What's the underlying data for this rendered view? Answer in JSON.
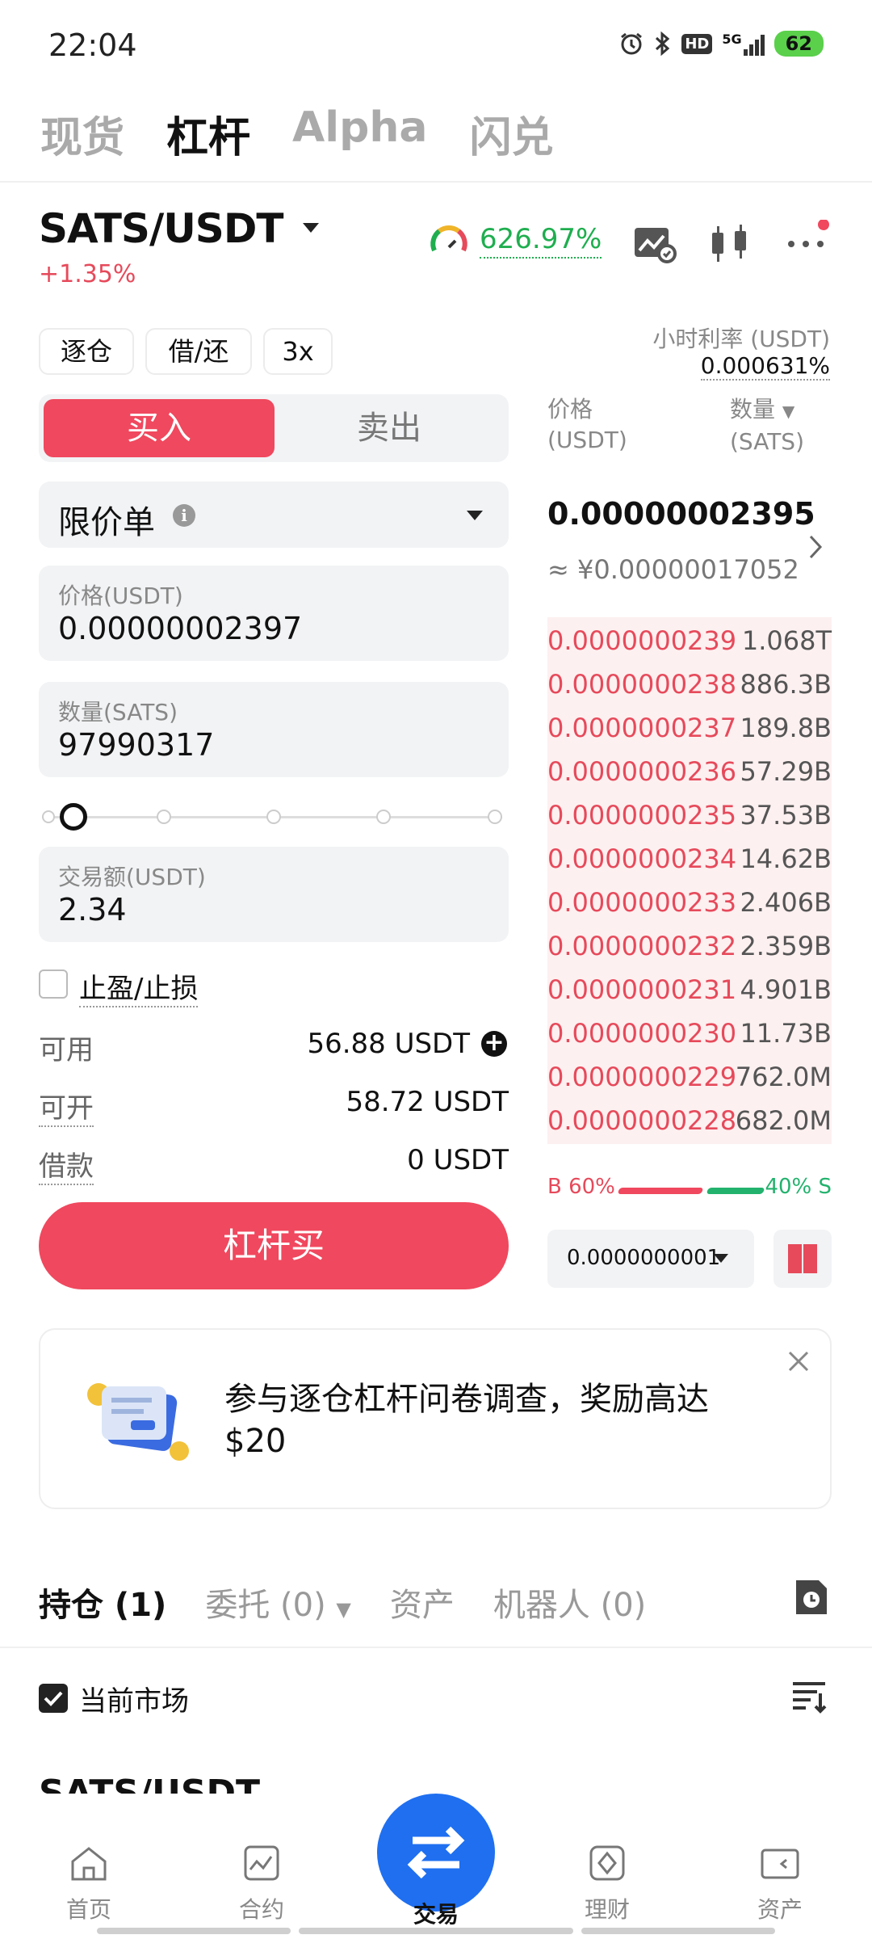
{
  "status_bar": {
    "time": "22:04",
    "network": "5G",
    "hd": "HD",
    "battery": "62"
  },
  "top_tabs": [
    {
      "label": "现货",
      "active": false
    },
    {
      "label": "杠杆",
      "active": true
    },
    {
      "label": "Alpha",
      "active": false
    },
    {
      "label": "闪兑",
      "active": false
    }
  ],
  "pair": {
    "name": "SATS/USDT",
    "change": "+1.35%",
    "rate": "626.97%"
  },
  "chips": {
    "mode": "逐仓",
    "borrow": "借/还",
    "leverage": "3x"
  },
  "hourly_rate": {
    "label": "小时利率 (USDT)",
    "value": "0.000631%"
  },
  "trade_toggle": {
    "buy": "买入",
    "sell": "卖出"
  },
  "order_type": {
    "label": "限价单"
  },
  "price_field": {
    "label": "价格(USDT)",
    "value": "0.00000002397"
  },
  "qty_field": {
    "label": "数量(SATS)",
    "value": "97990317"
  },
  "slider": {
    "percent": 0
  },
  "amount_field": {
    "label": "交易额(USDT)",
    "value": "2.34"
  },
  "tpsl": {
    "label": "止盈/止损",
    "checked": false
  },
  "info_rows": [
    {
      "label": "可用",
      "value": "56.88 USDT"
    },
    {
      "label": "可开",
      "value": "58.72 USDT"
    },
    {
      "label": "借款",
      "value": "0 USDT"
    }
  ],
  "action_button": {
    "label": "杠杆买"
  },
  "order_book": {
    "price_header": "价格\n(USDT)",
    "price_header_line1": "价格",
    "price_header_line2": "(USDT)",
    "qty_header_line1": "数量",
    "qty_header_line2": "(SATS)",
    "last_price": "0.00000002395",
    "last_price_cny": "≈ ¥0.00000017052",
    "asks": [
      {
        "price": "0.0000000239",
        "qty": "1.068T"
      },
      {
        "price": "0.0000000238",
        "qty": "886.3B"
      },
      {
        "price": "0.0000000237",
        "qty": "189.8B"
      },
      {
        "price": "0.0000000236",
        "qty": "57.29B"
      },
      {
        "price": "0.0000000235",
        "qty": "37.53B"
      },
      {
        "price": "0.0000000234",
        "qty": "14.62B"
      },
      {
        "price": "0.0000000233",
        "qty": "2.406B"
      },
      {
        "price": "0.0000000232",
        "qty": "2.359B"
      },
      {
        "price": "0.0000000231",
        "qty": "4.901B"
      },
      {
        "price": "0.0000000230",
        "qty": "11.73B"
      },
      {
        "price": "0.0000000229",
        "qty": "762.0M"
      },
      {
        "price": "0.0000000228",
        "qty": "682.0M"
      }
    ],
    "buy_ratio": "B 60%",
    "sell_ratio": "40% S",
    "depth": "0.0000000001"
  },
  "banner": {
    "text": "参与逐仓杠杆问卷调查，奖励高达 $20"
  },
  "bottom_tabs": [
    {
      "label": "持仓 (1)",
      "active": true
    },
    {
      "label": "委托 (0)",
      "active": false
    },
    {
      "label": "资产",
      "active": false
    },
    {
      "label": "机器人 (0)",
      "active": false
    }
  ],
  "current_market": {
    "label": "当前市场",
    "checked": true
  },
  "position_pair": "SATS/USDT",
  "nav": [
    {
      "label": "首页",
      "icon": "home-icon"
    },
    {
      "label": "合约",
      "icon": "chart-icon"
    },
    {
      "label": "交易",
      "icon": "swap-icon"
    },
    {
      "label": "理财",
      "icon": "finance-icon"
    },
    {
      "label": "资产",
      "icon": "wallet-icon"
    }
  ],
  "colors": {
    "red": "#f0485e",
    "green": "#1fae4f",
    "blue": "#1f6ff0"
  }
}
